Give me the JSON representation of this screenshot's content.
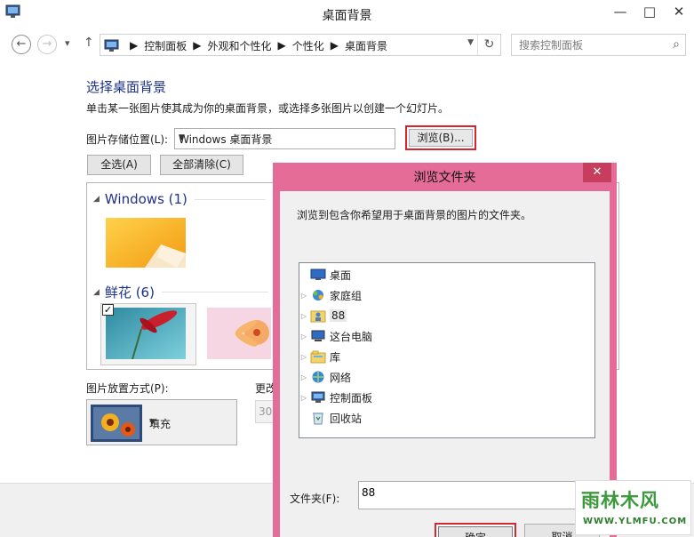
{
  "window": {
    "title": "桌面背景",
    "minimize": "—",
    "maximize": "□",
    "close": "✕"
  },
  "nav": {
    "back": "←",
    "forward": "→",
    "recent": "▾",
    "up": "↑",
    "breadcrumb": [
      "控制面板",
      "外观和个性化",
      "个性化",
      "桌面背景"
    ],
    "refresh": "↻",
    "search_placeholder": "搜索控制面板"
  },
  "page": {
    "heading": "选择桌面背景",
    "subtitle": "单击某一张图片使其成为你的桌面背景，或选择多张图片以创建一个幻灯片。",
    "location_label": "图片存储位置(L):",
    "location_value": "Windows 桌面背景",
    "browse_label": "浏览(B)...",
    "select_all": "全选(A)",
    "clear_all": "全部清除(C)",
    "groups": [
      {
        "name": "Windows (1)"
      },
      {
        "name": "鲜花 (6)"
      }
    ],
    "position_label": "图片放置方式(P):",
    "position_value": "填充",
    "change_label": "更改",
    "interval_value": "30"
  },
  "dialog": {
    "title": "浏览文件夹",
    "close": "✕",
    "description": "浏览到包含你希望用于桌面背景的图片的文件夹。",
    "tree": [
      {
        "label": "桌面",
        "icon": "desktop-icon",
        "expandable": false
      },
      {
        "label": "家庭组",
        "icon": "homegroup-icon",
        "expandable": true
      },
      {
        "label": "88",
        "icon": "user-folder-icon",
        "expandable": true
      },
      {
        "label": "这台电脑",
        "icon": "computer-icon",
        "expandable": true
      },
      {
        "label": "库",
        "icon": "library-icon",
        "expandable": true
      },
      {
        "label": "网络",
        "icon": "network-icon",
        "expandable": true
      },
      {
        "label": "控制面板",
        "icon": "control-panel-icon",
        "expandable": true
      },
      {
        "label": "回收站",
        "icon": "recycle-bin-icon",
        "expandable": false
      }
    ],
    "folder_label": "文件夹(F):",
    "folder_value": "88",
    "ok": "确定",
    "cancel": "取消"
  },
  "watermark": {
    "text": "雨林木风",
    "url": "WWW.YLMFU.COM"
  },
  "colors": {
    "dialog_frame": "#e46c96",
    "highlight": "#d8262e",
    "heading": "#1e3287"
  }
}
